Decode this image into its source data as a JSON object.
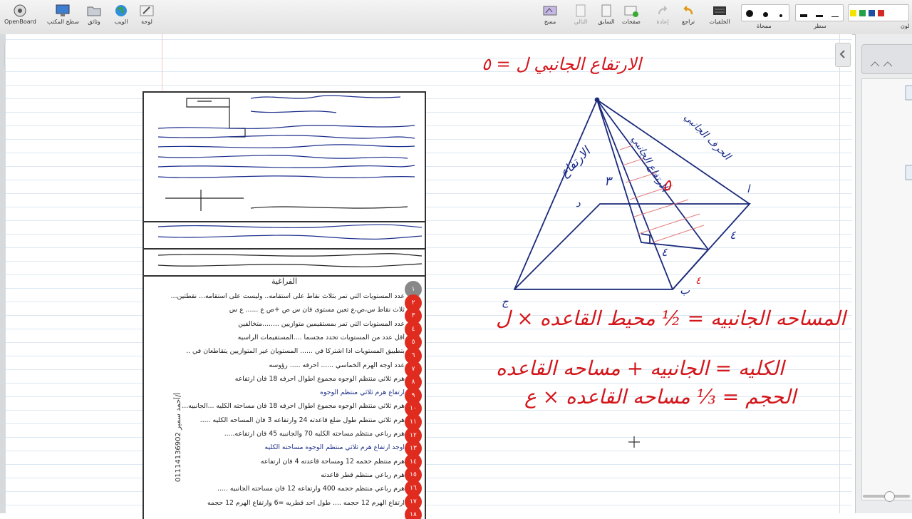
{
  "toolbar": {
    "left": [
      {
        "label": "OpenBoard",
        "icon": "openboard-logo-icon"
      },
      {
        "label": "سطح المكتب",
        "icon": "desktop-icon"
      },
      {
        "label": "وثائق",
        "icon": "folder-icon"
      },
      {
        "label": "الويب",
        "icon": "globe-icon"
      },
      {
        "label": "لوحة",
        "icon": "pencil-board-icon"
      }
    ],
    "right": [
      {
        "label": "مسح",
        "icon": "erase-board-icon",
        "disabled": false
      },
      {
        "label": "التالي",
        "icon": "next-page-icon",
        "disabled": true
      },
      {
        "label": "السابق",
        "icon": "previous-page-icon",
        "disabled": true
      },
      {
        "label": "صفحات",
        "icon": "add-page-icon",
        "disabled": false
      },
      {
        "label": "إعادة",
        "icon": "redo-icon",
        "disabled": true
      },
      {
        "label": "تراجع",
        "icon": "undo-icon",
        "disabled": false
      },
      {
        "label": "الخلفيات",
        "icon": "backgrounds-icon",
        "disabled": false
      }
    ],
    "eraser_label": "ممحاة",
    "line_label": "سطر",
    "color_label": "لون",
    "colors": [
      "#f4e200",
      "#22a14a",
      "#1f4fa3",
      "#d42a25"
    ]
  },
  "sheet": {
    "title": "الفراغية",
    "rows": [
      "عدد المستويات التي تمر بثلاث نقاط على استقامه.. وليست على استقامه... نقطتين...",
      "ثلاث نقاط س،ص،ع تعين مستوى فان س ص +ص ع ...... ع س",
      "عدد المستويات التي تمر بمستقيمين متوازيين ........متخالفين",
      "أقل عدد من المستويات تحدد مجسماً ....المستقيمات الراسيه",
      "بتطبيق المستويات اذا اشتركا في ...... المستويان غير المتوازيين يتقاطعان في ..",
      "عدد اوجه الهرم الخماسي ...... احرفه ..... رؤوسه",
      "هرم ثلاثي منتظم الوجوه مجموع اطوال احرفه 18 فان ارتفاعه",
      "ارتفاع هرم ثلاثي منتظم الوجوه",
      "هرم ثلاثي منتظم الوجوه مجموع اطوال احرفه 18 فان مساحته الكليه ...الجانبيه...",
      "هرم ثلاثي منتظم طول ضلع قاعدته 24 وارتفاعه 3 فان المساحه الكليه .....",
      "هرم رباعي منتظم مساحته الكليه 70 والجانبيه 45 فان ارتفاعه.....",
      "اوجد ارتفاع هرم ثلاثي منتظم الوجوه مساحته الكليه",
      "هرم منتظم حجمه 12 ومساحة قاعدته 4 فان ارتفاعه",
      "هرم رباعي منتظم قطر قاعدته",
      "هرم رباعي منتظم حجمه 400 وارتفاعه 12 فان مساحته الجانبيه .....",
      "ارتفاع الهرم 12 حجمه .... طول احد قطريه =6 وارتفاع الهرم 12 حجمه"
    ],
    "numbers": [
      "١",
      "٢",
      "٣",
      "٤",
      "٥",
      "٦",
      "٧",
      "٨",
      "٩",
      "١٠",
      "١١",
      "١٢",
      "١٣",
      "١٤",
      "١٥",
      "١٦",
      "١٧",
      "١٨"
    ],
    "phone": "أ/أحمد سمير 01114136902"
  },
  "ink": {
    "height_title": "الارتفاع الجانبي ل = ٥",
    "label_height": "الارتفاع",
    "label_slant": "الارتفاع الجانبي",
    "label_edge": "الحرف الجانبي",
    "area_formula": "المساحه الجانبيه = ½ محيط القاعده × ل",
    "total_formula": "الكليه = الجانبيه + مساحه القاعده",
    "volume_formula": "الحجم = ⅓ مساحه القاعده × ع",
    "num_three": "٣",
    "num_five": "٥",
    "num_four": "٤",
    "num_four_b": "٤",
    "num_four_c": "٤",
    "pt_a": "ا",
    "pt_b": "ب",
    "pt_c": "ج",
    "pt_d": "د"
  }
}
